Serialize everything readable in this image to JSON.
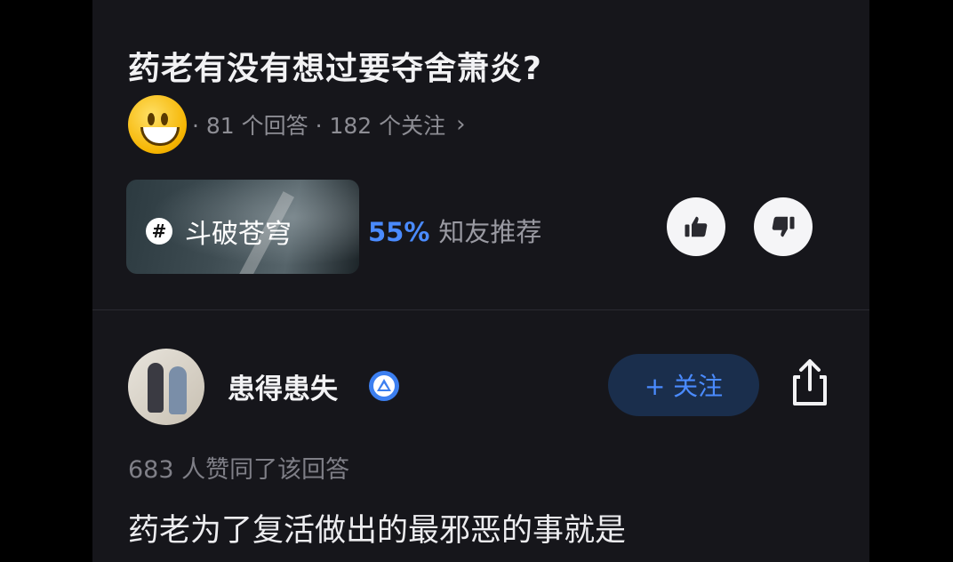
{
  "question": {
    "title": "药老有没有想过要夺舍萧炎?",
    "meta": "· 81 个回答 · 182 个关注",
    "chevron": "›"
  },
  "topic": {
    "hash_symbol": "#",
    "name": "斗破苍穹",
    "recommend_pct": "55%",
    "recommend_label": "知友推荐"
  },
  "answer": {
    "author_name": "患得患失",
    "follow_label": "+ 关注",
    "agree_text": "683 人赞同了该回答",
    "first_line": "药老为了复活做出的最邪恶的事就是"
  },
  "colors": {
    "accent": "#4a8bff",
    "background": "#16161b",
    "follow_bg": "#1a2e4c"
  },
  "icons": [
    "smiley-emoji-icon",
    "hash-icon",
    "thumbs-up-icon",
    "thumbs-down-icon",
    "verified-badge-icon",
    "share-icon"
  ]
}
